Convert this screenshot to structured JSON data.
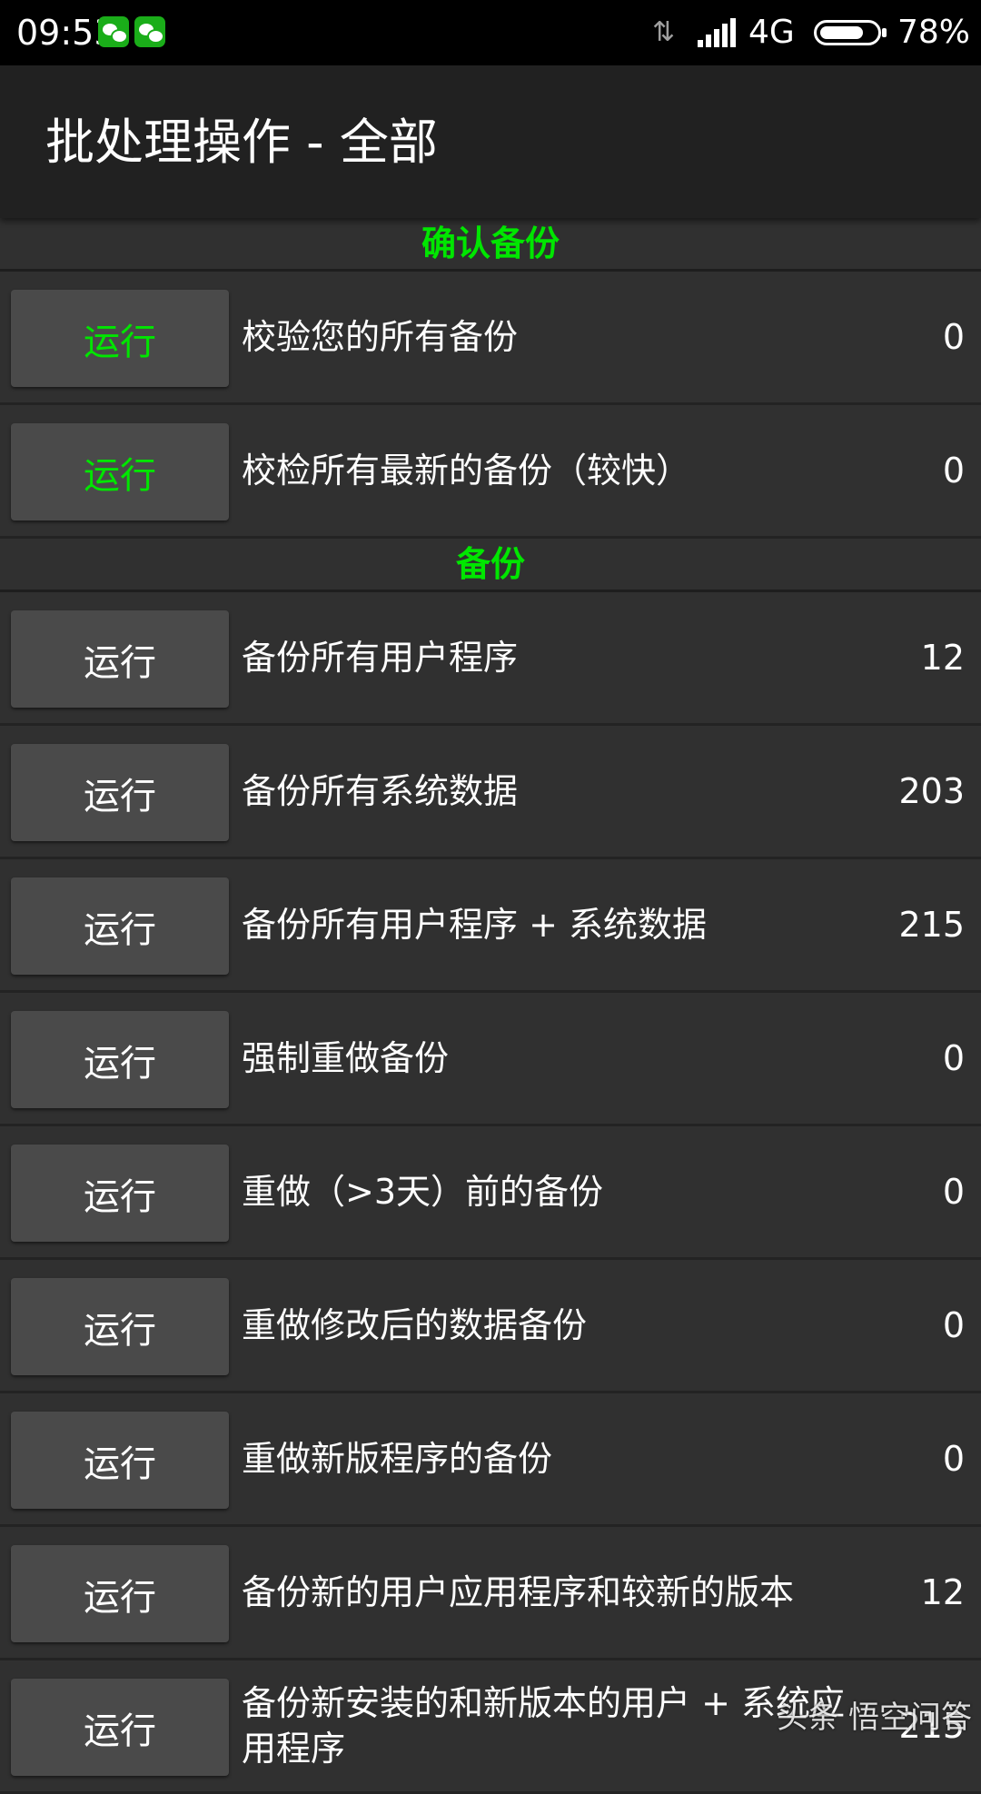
{
  "status_bar": {
    "time": "09:53",
    "network": "4G",
    "battery": "78%",
    "battery_level": 0.78,
    "icons": [
      "wechat-icon",
      "wechat-icon",
      "data-transfer-icon",
      "signal-icon",
      "battery-icon"
    ]
  },
  "app_bar": {
    "title": "批处理操作 - 全部"
  },
  "colors": {
    "section_header": "#00e600",
    "background": "#303030",
    "app_bar": "#212121",
    "button": "#4a4a4a"
  },
  "sections": [
    {
      "title": "确认备份",
      "rows": [
        {
          "button": "运行",
          "label": "校验您的所有备份",
          "count": "0"
        },
        {
          "button": "运行",
          "label": "校检所有最新的备份（较快）",
          "count": "0"
        }
      ]
    },
    {
      "title": "备份",
      "rows": [
        {
          "button": "运行",
          "label": "备份所有用户程序",
          "count": "12"
        },
        {
          "button": "运行",
          "label": "备份所有系统数据",
          "count": "203"
        },
        {
          "button": "运行",
          "label": "备份所有用户程序 + 系统数据",
          "count": "215"
        },
        {
          "button": "运行",
          "label": "强制重做备份",
          "count": "0"
        },
        {
          "button": "运行",
          "label": "重做（>3天）前的备份",
          "count": "0"
        },
        {
          "button": "运行",
          "label": "重做修改后的数据备份",
          "count": "0"
        },
        {
          "button": "运行",
          "label": "重做新版程序的备份",
          "count": "0"
        },
        {
          "button": "运行",
          "label": "备份新的用户应用程序和较新的版本",
          "count": "12"
        },
        {
          "button": "运行",
          "label": "备份新安装的和新版本的用户 + 系统应用程序",
          "count": "215"
        }
      ]
    }
  ],
  "watermark": "头条 悟空问答"
}
